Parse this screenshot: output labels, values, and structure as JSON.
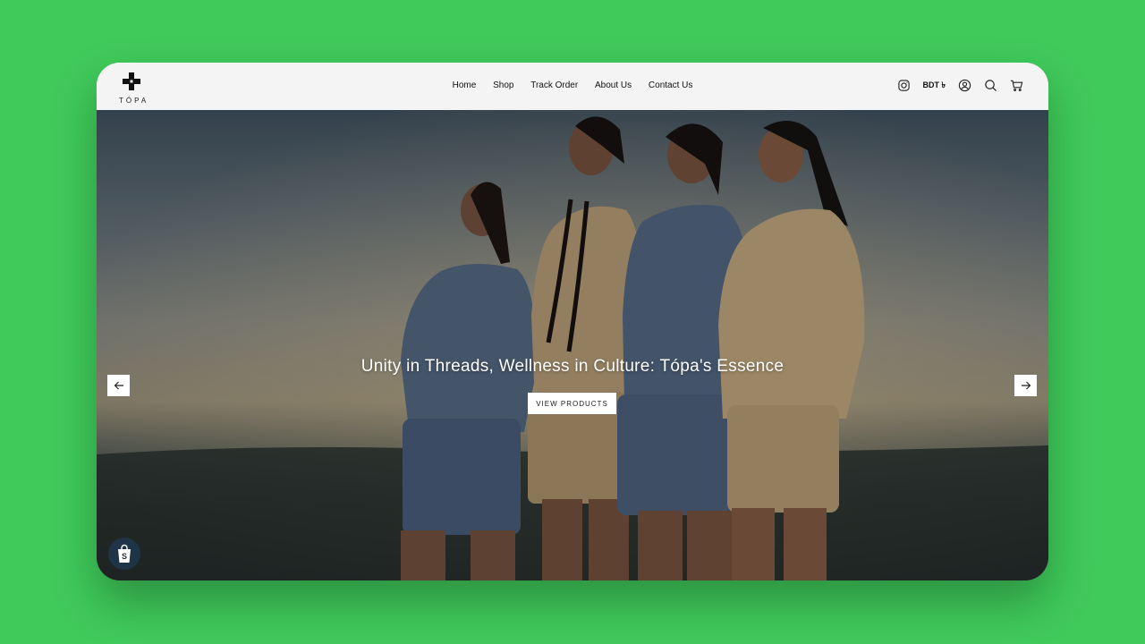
{
  "brand": {
    "name": "TÓPA"
  },
  "nav": {
    "items": [
      {
        "label": "Home"
      },
      {
        "label": "Shop"
      },
      {
        "label": "Track Order"
      },
      {
        "label": "About Us"
      },
      {
        "label": "Contact Us"
      }
    ]
  },
  "header_icons": {
    "currency": "BDT ৳",
    "icons": [
      "instagram-icon",
      "account-icon",
      "search-icon",
      "cart-icon"
    ]
  },
  "hero": {
    "headline": "Unity in Threads, Wellness in Culture: Tópa's Essence",
    "cta_label": "VIEW PRODUCTS"
  },
  "colors": {
    "background": "#3fca5a",
    "header": "#f4f4f4",
    "shopify_badge": "#1f3446"
  }
}
